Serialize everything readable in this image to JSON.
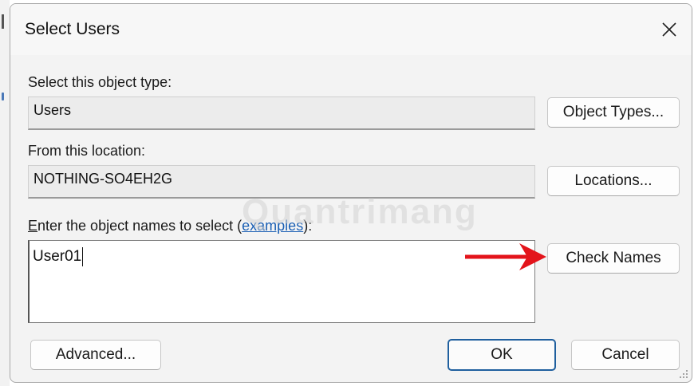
{
  "dialog": {
    "title": "Select Users",
    "close_icon": "close-icon"
  },
  "object_type": {
    "label": "Select this object type:",
    "value": "Users",
    "button_label": "Object Types..."
  },
  "location": {
    "label": "From this location:",
    "value": "NOTHING-SO4EH2G",
    "button_label": "Locations..."
  },
  "names": {
    "label_prefix_accel": "E",
    "label_prefix_rest": "nter the object names to select (",
    "label_link": "examples",
    "label_suffix": "):",
    "value": "User01",
    "check_button_label": "Check Names"
  },
  "footer": {
    "advanced_label": "Advanced...",
    "ok_label": "OK",
    "cancel_label": "Cancel"
  },
  "watermark_text": "Quantrimang",
  "annotation": {
    "arrow_color": "#e3141b",
    "arrow_icon": "red-arrow-right-icon"
  }
}
